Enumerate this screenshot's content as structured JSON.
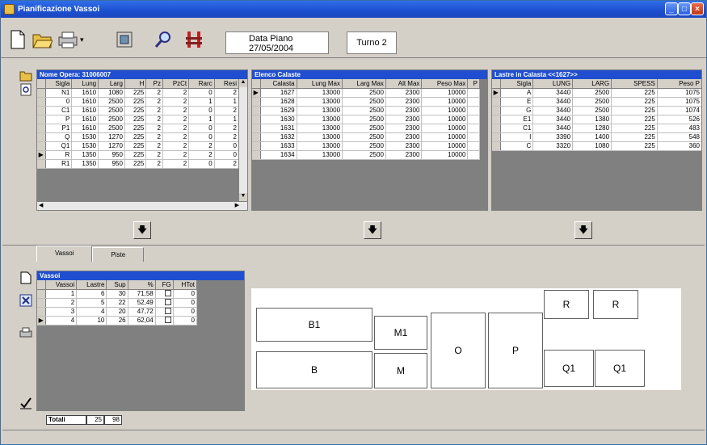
{
  "window": {
    "title": "Pianificazione Vassoi"
  },
  "toolbar": {
    "data_piano_label": "Data Piano",
    "data_piano_value": "27/05/2004",
    "turno": "Turno 2",
    "icons": [
      "new-document-icon",
      "open-folder-icon",
      "print-icon",
      "export-icon",
      "search-icon",
      "flight-icon"
    ]
  },
  "opera": {
    "title": "Nome Opera: 31006007",
    "columns": [
      "Sigla",
      "Lung",
      "Larg",
      "H",
      "Pz",
      "PzCt",
      "Rarc",
      "Resi"
    ],
    "rows": [
      [
        "N1",
        "1610",
        "1080",
        "225",
        "2",
        "2",
        "0",
        "2"
      ],
      [
        "0",
        "1610",
        "2500",
        "225",
        "2",
        "2",
        "1",
        "1"
      ],
      [
        "C1",
        "1610",
        "2500",
        "225",
        "2",
        "2",
        "0",
        "2"
      ],
      [
        "P",
        "1610",
        "2500",
        "225",
        "2",
        "2",
        "1",
        "1"
      ],
      [
        "P1",
        "1610",
        "2500",
        "225",
        "2",
        "2",
        "0",
        "2"
      ],
      [
        "Q",
        "1530",
        "1270",
        "225",
        "2",
        "2",
        "0",
        "2"
      ],
      [
        "Q1",
        "1530",
        "1270",
        "225",
        "2",
        "2",
        "2",
        "0"
      ],
      [
        "R",
        "1350",
        "950",
        "225",
        "2",
        "2",
        "2",
        "0"
      ],
      [
        "R1",
        "1350",
        "950",
        "225",
        "2",
        "2",
        "0",
        "2"
      ]
    ],
    "current_row": 7
  },
  "calaste": {
    "title": "Elenco Calaste",
    "columns": [
      "Calasta",
      "Lung Max",
      "Larg Max",
      "Alt Max",
      "Peso Max",
      "P"
    ],
    "rows": [
      [
        "1627",
        "13000",
        "2500",
        "2300",
        "10000"
      ],
      [
        "1628",
        "13000",
        "2500",
        "2300",
        "10000"
      ],
      [
        "1629",
        "13000",
        "2500",
        "2300",
        "10000"
      ],
      [
        "1630",
        "13000",
        "2500",
        "2300",
        "10000"
      ],
      [
        "1631",
        "13000",
        "2500",
        "2300",
        "10000"
      ],
      [
        "1632",
        "13000",
        "2500",
        "2300",
        "10000"
      ],
      [
        "1633",
        "13000",
        "2500",
        "2300",
        "10000"
      ],
      [
        "1634",
        "13000",
        "2500",
        "2300",
        "10000"
      ]
    ],
    "current_row": 0
  },
  "lastre": {
    "title": "Lastre in Calasta <<1627>>",
    "columns": [
      "Sigla",
      "LUNG",
      "LARG",
      "SPESS",
      "Peso P"
    ],
    "rows": [
      [
        "A",
        "3440",
        "2500",
        "225",
        "1075"
      ],
      [
        "E",
        "3440",
        "2500",
        "225",
        "1075"
      ],
      [
        "G",
        "3440",
        "2500",
        "225",
        "1074"
      ],
      [
        "E1",
        "3440",
        "1380",
        "225",
        "526"
      ],
      [
        "C1",
        "3440",
        "1280",
        "225",
        "483"
      ],
      [
        "I",
        "3390",
        "1400",
        "225",
        "548"
      ],
      [
        "C",
        "3320",
        "1080",
        "225",
        "360"
      ]
    ],
    "current_row": 0
  },
  "tabs": [
    {
      "label": "Vassoi"
    },
    {
      "label": "Piste"
    }
  ],
  "vassoi": {
    "title": "Vassoi",
    "columns": [
      "Vassoi",
      "Lastre",
      "Sup",
      "%",
      "FG",
      "HTot"
    ],
    "rows": [
      [
        "1",
        "6",
        "30",
        "71,58",
        "0"
      ],
      [
        "2",
        "5",
        "22",
        "52,49",
        "0"
      ],
      [
        "3",
        "4",
        "20",
        "47,72",
        "0"
      ],
      [
        "4",
        "10",
        "26",
        "62,04",
        "0"
      ]
    ],
    "current_row": 3,
    "totali_label": "Totali",
    "totali_lastre": "25",
    "totali_sup": "98"
  },
  "drawing": {
    "plates": [
      "B1",
      "M1",
      "O",
      "P",
      "R",
      "R",
      "B",
      "M",
      "Q1",
      "Q1"
    ]
  }
}
